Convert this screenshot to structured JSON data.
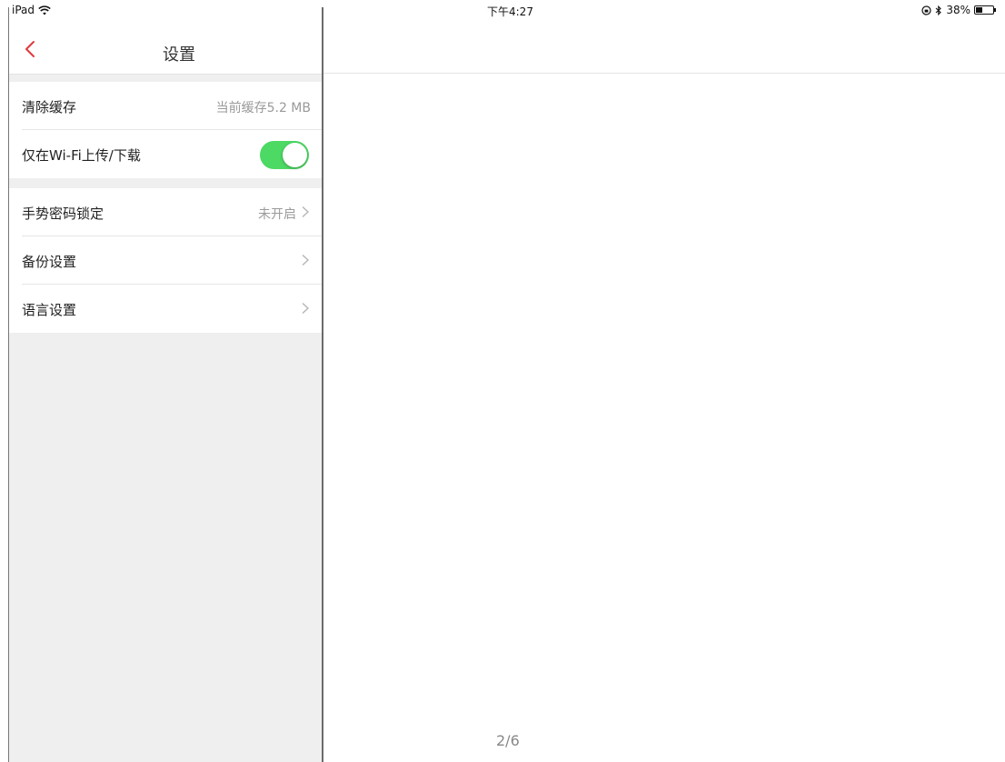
{
  "statusbar": {
    "device": "iPad",
    "time": "下午4:27",
    "battery_percent_text": "38%",
    "battery_level": 0.38
  },
  "sidebar": {
    "nav": {
      "title": "设置"
    },
    "group1": {
      "clear_cache": {
        "label": "清除缓存",
        "value": "当前缓存5.2 MB"
      },
      "wifi_only": {
        "label": "仅在Wi-Fi上传/下载",
        "toggle_on": true
      }
    },
    "group2": {
      "gesture_lock": {
        "label": "手势密码锁定",
        "value": "未开启"
      },
      "backup": {
        "label": "备份设置"
      },
      "language": {
        "label": "语言设置"
      }
    }
  },
  "content": {
    "pager": "2/6"
  },
  "colors": {
    "accent_red": "#e0393e",
    "toggle_green": "#4cd964",
    "sidebar_bg": "#efefef"
  }
}
